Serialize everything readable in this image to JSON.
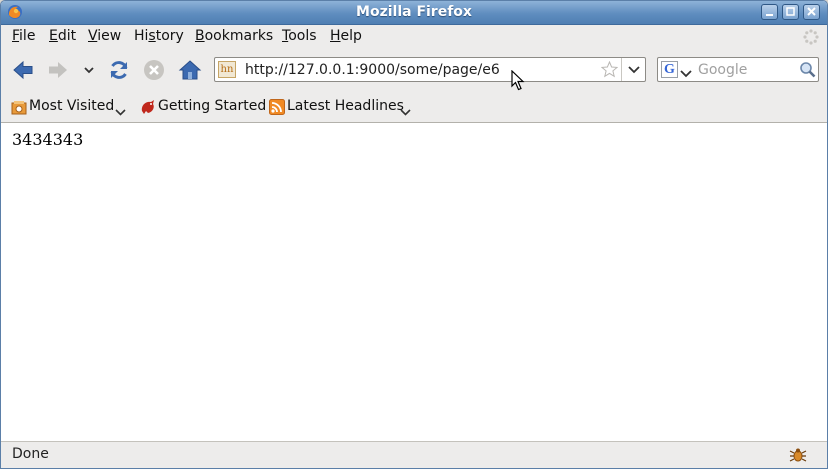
{
  "window": {
    "title": "Mozilla Firefox"
  },
  "menu": [
    "File",
    "Edit",
    "View",
    "History",
    "Bookmarks",
    "Tools",
    "Help"
  ],
  "menu_mnemonic": [
    "F",
    "E",
    "V",
    "s",
    "B",
    "T",
    "H"
  ],
  "navigation": {
    "url": "http://127.0.0.1:9000/some/page/e6",
    "site_icon_text": "hn",
    "search_placeholder": "Google",
    "search_engine_letter": "G"
  },
  "bookmarks": [
    {
      "label": "Most Visited",
      "icon": "most-visited-icon",
      "dropdown": true
    },
    {
      "label": "Getting Started",
      "icon": "firefox-bookmark-icon",
      "dropdown": false
    },
    {
      "label": "Latest Headlines",
      "icon": "rss-feed-icon",
      "dropdown": true
    }
  ],
  "page": {
    "text": "3434343"
  },
  "status": {
    "text": "Done"
  },
  "colors": {
    "titlebar": "#5f8dbf",
    "nav_arrow": "#3c6ab0",
    "rss": "#f08a24"
  }
}
